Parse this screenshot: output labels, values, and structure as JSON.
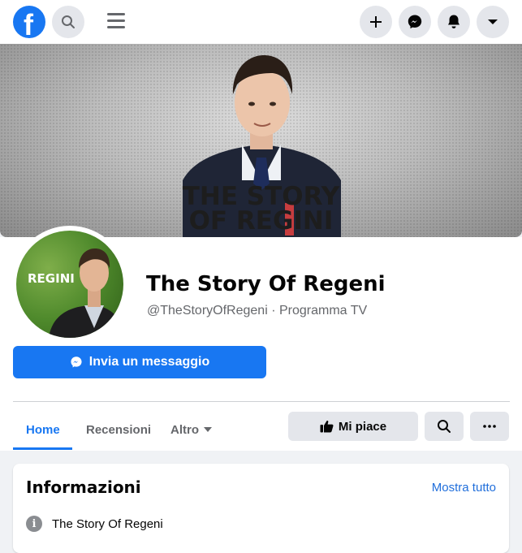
{
  "topbar": {
    "logo_letter": "f",
    "icons": [
      "facebook-logo",
      "search-icon",
      "menu-icon",
      "plus-icon",
      "messenger-icon",
      "notifications-icon",
      "caret-down-icon"
    ]
  },
  "cover": {
    "line1": "THE STORY",
    "line2": "OF REGINI"
  },
  "avatar": {
    "label": "REGINI"
  },
  "page": {
    "name": "The Story Of Regeni",
    "handle": "@TheStoryOfRegeni · Programma TV"
  },
  "actions": {
    "message_label": "Invia un messaggio",
    "like_label": "Mi piace",
    "more_label": "···"
  },
  "tabs": [
    {
      "label": "Home",
      "active": true
    },
    {
      "label": "Recensioni",
      "active": false
    },
    {
      "label": "Altro",
      "active": false
    }
  ],
  "info_card": {
    "title": "Informazioni",
    "link": "Mostra tutto",
    "rows": [
      {
        "icon": "info-icon",
        "text": "The Story Of Regeni"
      }
    ]
  },
  "colors": {
    "accent": "#1877f2",
    "button_gray": "#e4e6eb",
    "text_secondary": "#65676b"
  }
}
